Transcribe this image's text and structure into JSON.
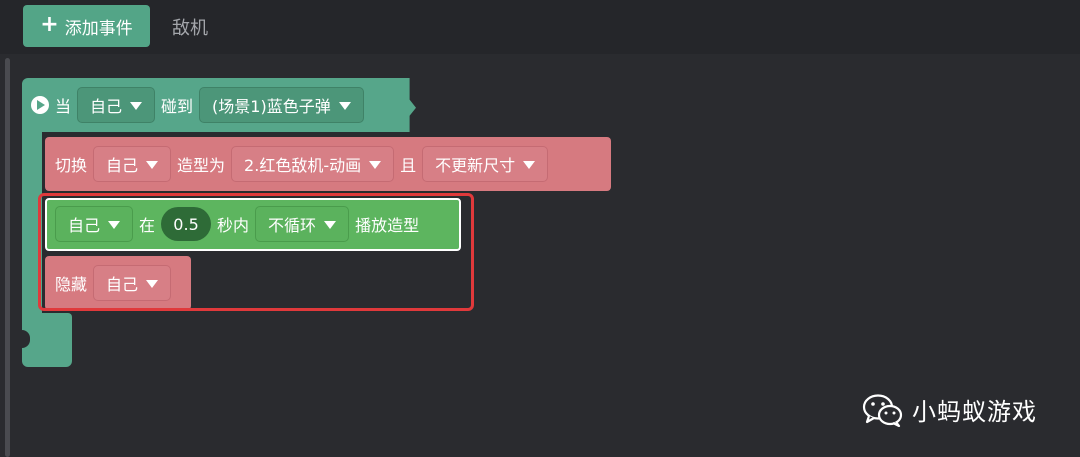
{
  "toolbar": {
    "add_event_label": "添加事件",
    "tab_label": "敌机"
  },
  "event_block": {
    "when_label": "当",
    "subject": "自己",
    "touch_label": "碰到",
    "target": "(场景1)蓝色子弹"
  },
  "switch_block": {
    "switch_label": "切换",
    "subject": "自己",
    "costume_label": "造型为",
    "costume": "2.红色敌机-动画",
    "and_label": "且",
    "resize": "不更新尺寸"
  },
  "anim_block": {
    "subject": "自己",
    "in_label": "在",
    "seconds": "0.5",
    "within_label": "秒内",
    "loop": "不循环",
    "play_label": "播放造型"
  },
  "hide_block": {
    "hide_label": "隐藏",
    "subject": "自己"
  },
  "watermark": {
    "text": "小蚂蚁游戏"
  },
  "colors": {
    "event_green": "#56a68a",
    "looks_pink": "#d67a80",
    "anim_green": "#5db55f",
    "highlight_red": "#e0393b"
  }
}
